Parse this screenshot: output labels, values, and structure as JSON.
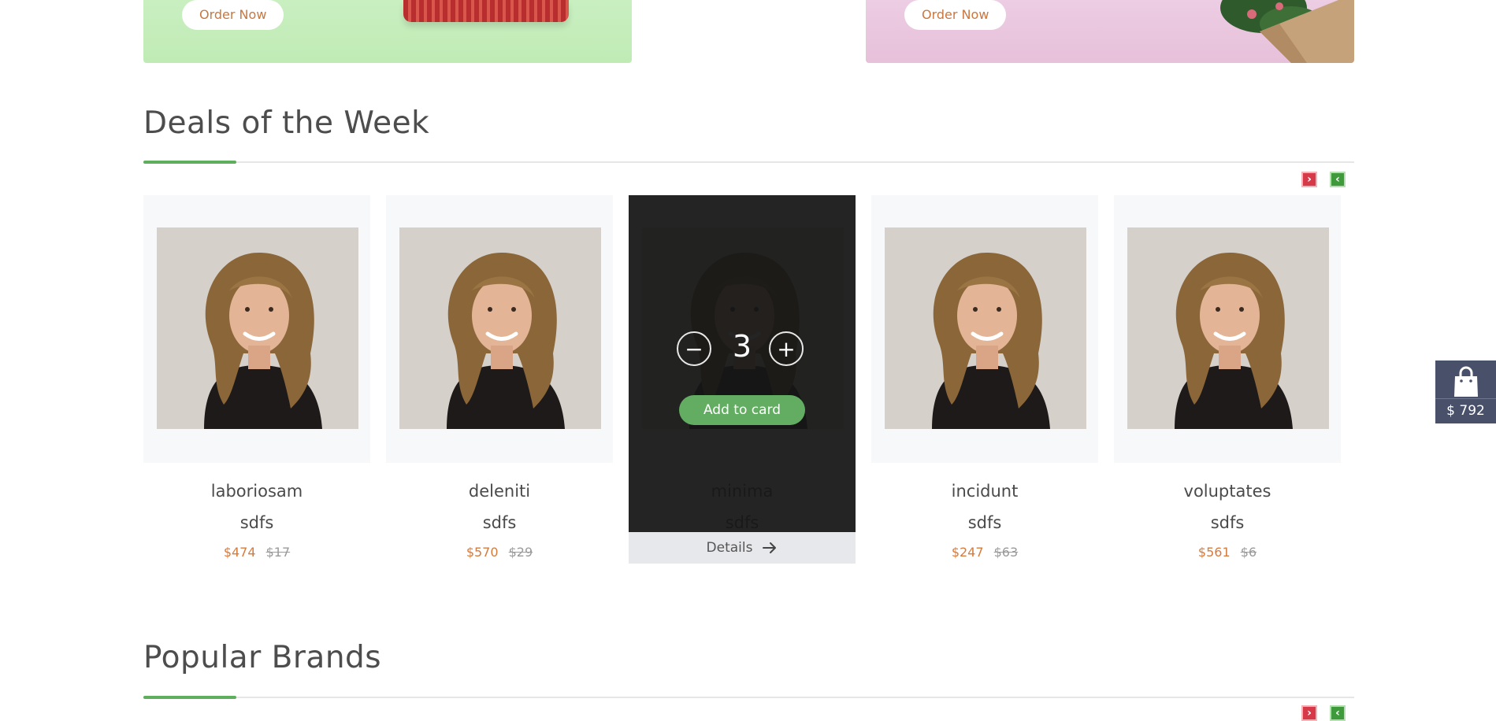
{
  "banners": [
    {
      "order_label": "Order Now"
    },
    {
      "order_label": "Order Now"
    }
  ],
  "deals": {
    "title": "Deals of the Week",
    "nav_next_icon": "arrow-right-icon",
    "nav_prev_icon": "arrow-left-icon",
    "products": [
      {
        "name": "laboriosam",
        "subtitle": "sdfs",
        "price": "$474",
        "old_price": "$17"
      },
      {
        "name": "deleniti",
        "subtitle": "sdfs",
        "price": "$570",
        "old_price": "$29"
      },
      {
        "name": "minima",
        "subtitle": "sdfs",
        "price": "",
        "old_price": "",
        "hover": true,
        "quantity": "3",
        "add_label": "Add to card",
        "details_label": "Details"
      },
      {
        "name": "incidunt",
        "subtitle": "sdfs",
        "price": "$247",
        "old_price": "$63"
      },
      {
        "name": "voluptates",
        "subtitle": "sdfs",
        "price": "$561",
        "old_price": "$6"
      }
    ]
  },
  "brands": {
    "title": "Popular Brands"
  },
  "cart": {
    "icon": "shopping-bag-icon",
    "total": "$ 792"
  },
  "colors": {
    "accent_green": "#5fae5e",
    "price_orange": "#d77a3d",
    "cart_bg": "#49506a"
  }
}
